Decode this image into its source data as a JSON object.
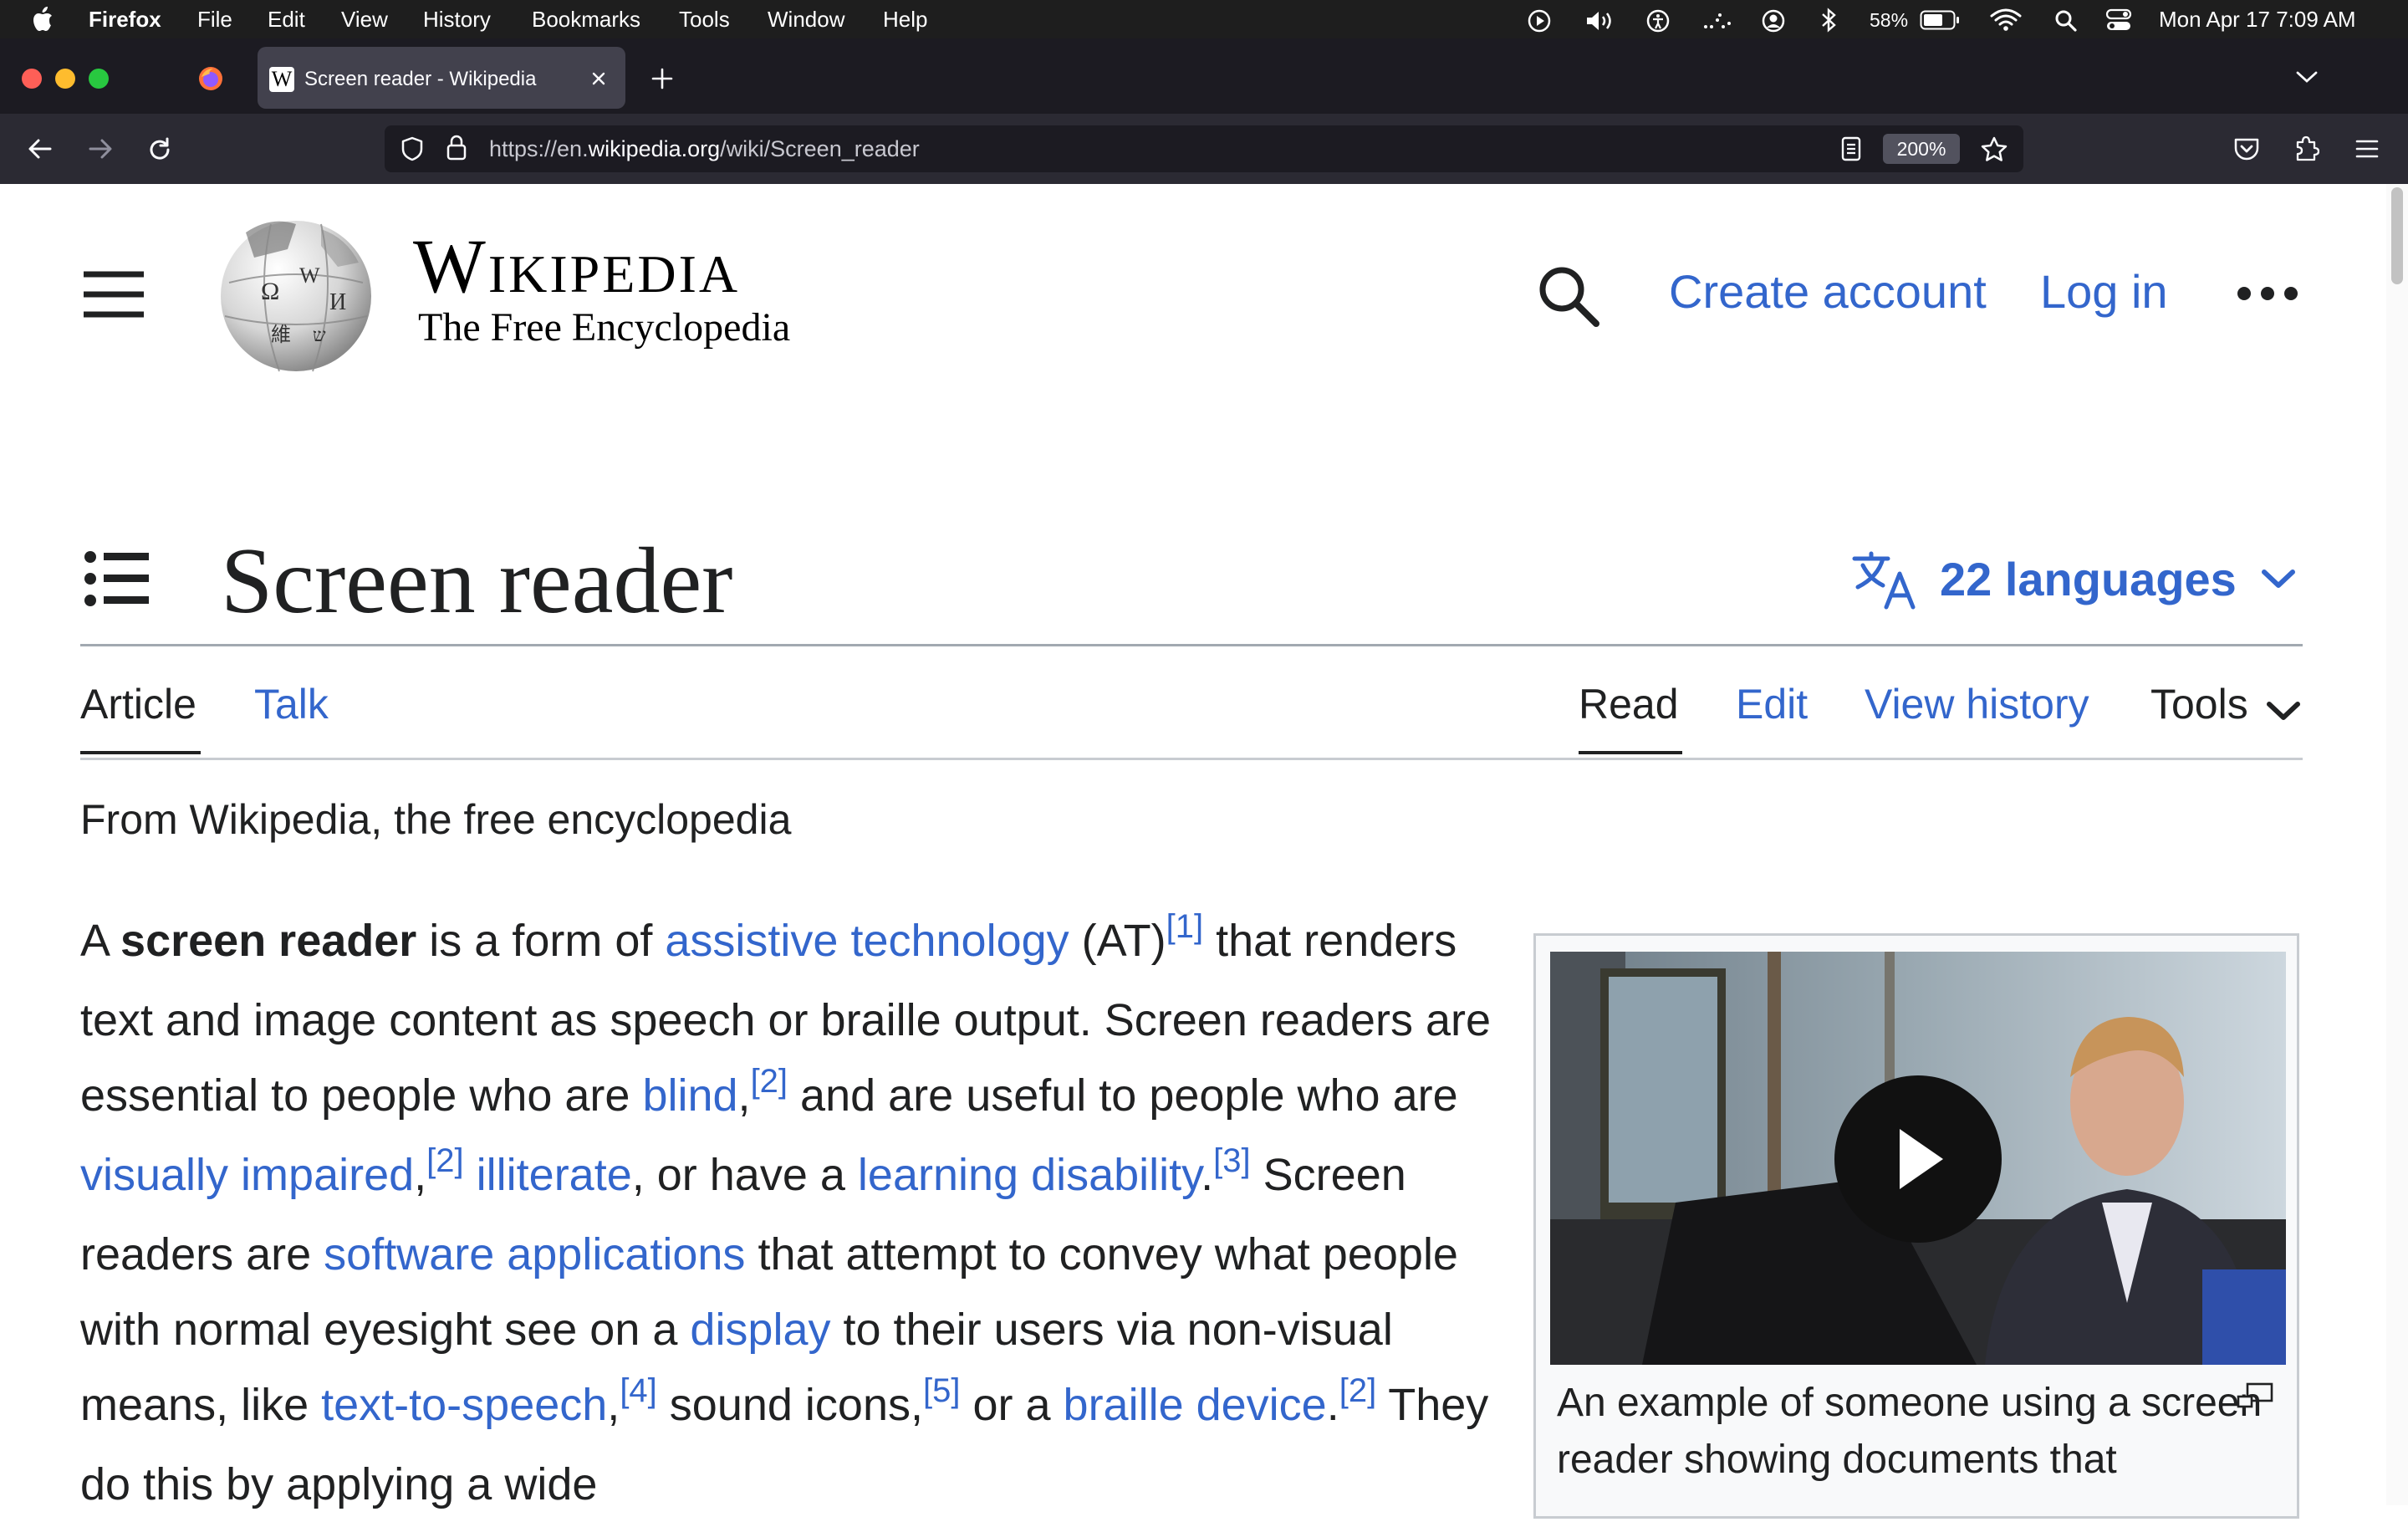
{
  "menubar": {
    "app_name": "Firefox",
    "items": [
      "File",
      "Edit",
      "View",
      "History",
      "Bookmarks",
      "Tools",
      "Window",
      "Help"
    ],
    "battery": "58%",
    "clock": "Mon Apr 17  7:09 AM"
  },
  "browser": {
    "tab_title": "Screen reader - Wikipedia",
    "tab_favicon_letter": "W",
    "url_prefix": "https://en.",
    "url_domain": "wikipedia.org",
    "url_path": "/wiki/Screen_reader",
    "zoom": "200%"
  },
  "wiki_header": {
    "wordmark": "Wikipedia",
    "tagline": "The Free Encyclopedia",
    "create_account": "Create account",
    "log_in": "Log in"
  },
  "article": {
    "title": "Screen reader",
    "languages": "22 languages",
    "tabs_left": [
      "Article",
      "Talk"
    ],
    "tabs_right": [
      "Read",
      "Edit",
      "View history",
      "Tools"
    ],
    "from_line": "From Wikipedia, the free encyclopedia",
    "paragraph": [
      {
        "t": "A "
      },
      {
        "t": "screen reader",
        "b": true
      },
      {
        "t": " is a form of "
      },
      {
        "t": "assistive technology",
        "link": true
      },
      {
        "t": " (AT)"
      },
      {
        "t": "[1]",
        "sup": true
      },
      {
        "t": " that renders text and image content as speech or braille output. Screen readers are essential to people who are "
      },
      {
        "t": "blind",
        "link": true
      },
      {
        "t": ","
      },
      {
        "t": "[2]",
        "sup": true
      },
      {
        "t": " and are useful to people who are "
      },
      {
        "t": "visually impaired",
        "link": true
      },
      {
        "t": ","
      },
      {
        "t": "[2]",
        "sup": true
      },
      {
        "t": " "
      },
      {
        "t": "illiterate",
        "link": true
      },
      {
        "t": ", or have a "
      },
      {
        "t": "learning disability",
        "link": true
      },
      {
        "t": "."
      },
      {
        "t": "[3]",
        "sup": true
      },
      {
        "t": " Screen readers are "
      },
      {
        "t": "software applications",
        "link": true
      },
      {
        "t": " that attempt to convey what people with normal eyesight see on a "
      },
      {
        "t": "display",
        "link": true
      },
      {
        "t": " to their users via non-visual means, like "
      },
      {
        "t": "text-to-speech",
        "link": true
      },
      {
        "t": ","
      },
      {
        "t": "[4]",
        "sup": true
      },
      {
        "t": " sound icons,"
      },
      {
        "t": "[5]",
        "sup": true
      },
      {
        "t": " or a "
      },
      {
        "t": "braille device",
        "link": true
      },
      {
        "t": "."
      },
      {
        "t": "[2]",
        "sup": true
      },
      {
        "t": " They do this by applying a wide"
      }
    ],
    "infobox_caption": "An example of someone using a screen reader showing documents that"
  },
  "colors": {
    "link": "#3366cc",
    "text": "#202122",
    "menubar_bg": "#1e1e1e",
    "tabstrip_bg": "#1c1b22",
    "toolbar_bg": "#2b2a33"
  }
}
